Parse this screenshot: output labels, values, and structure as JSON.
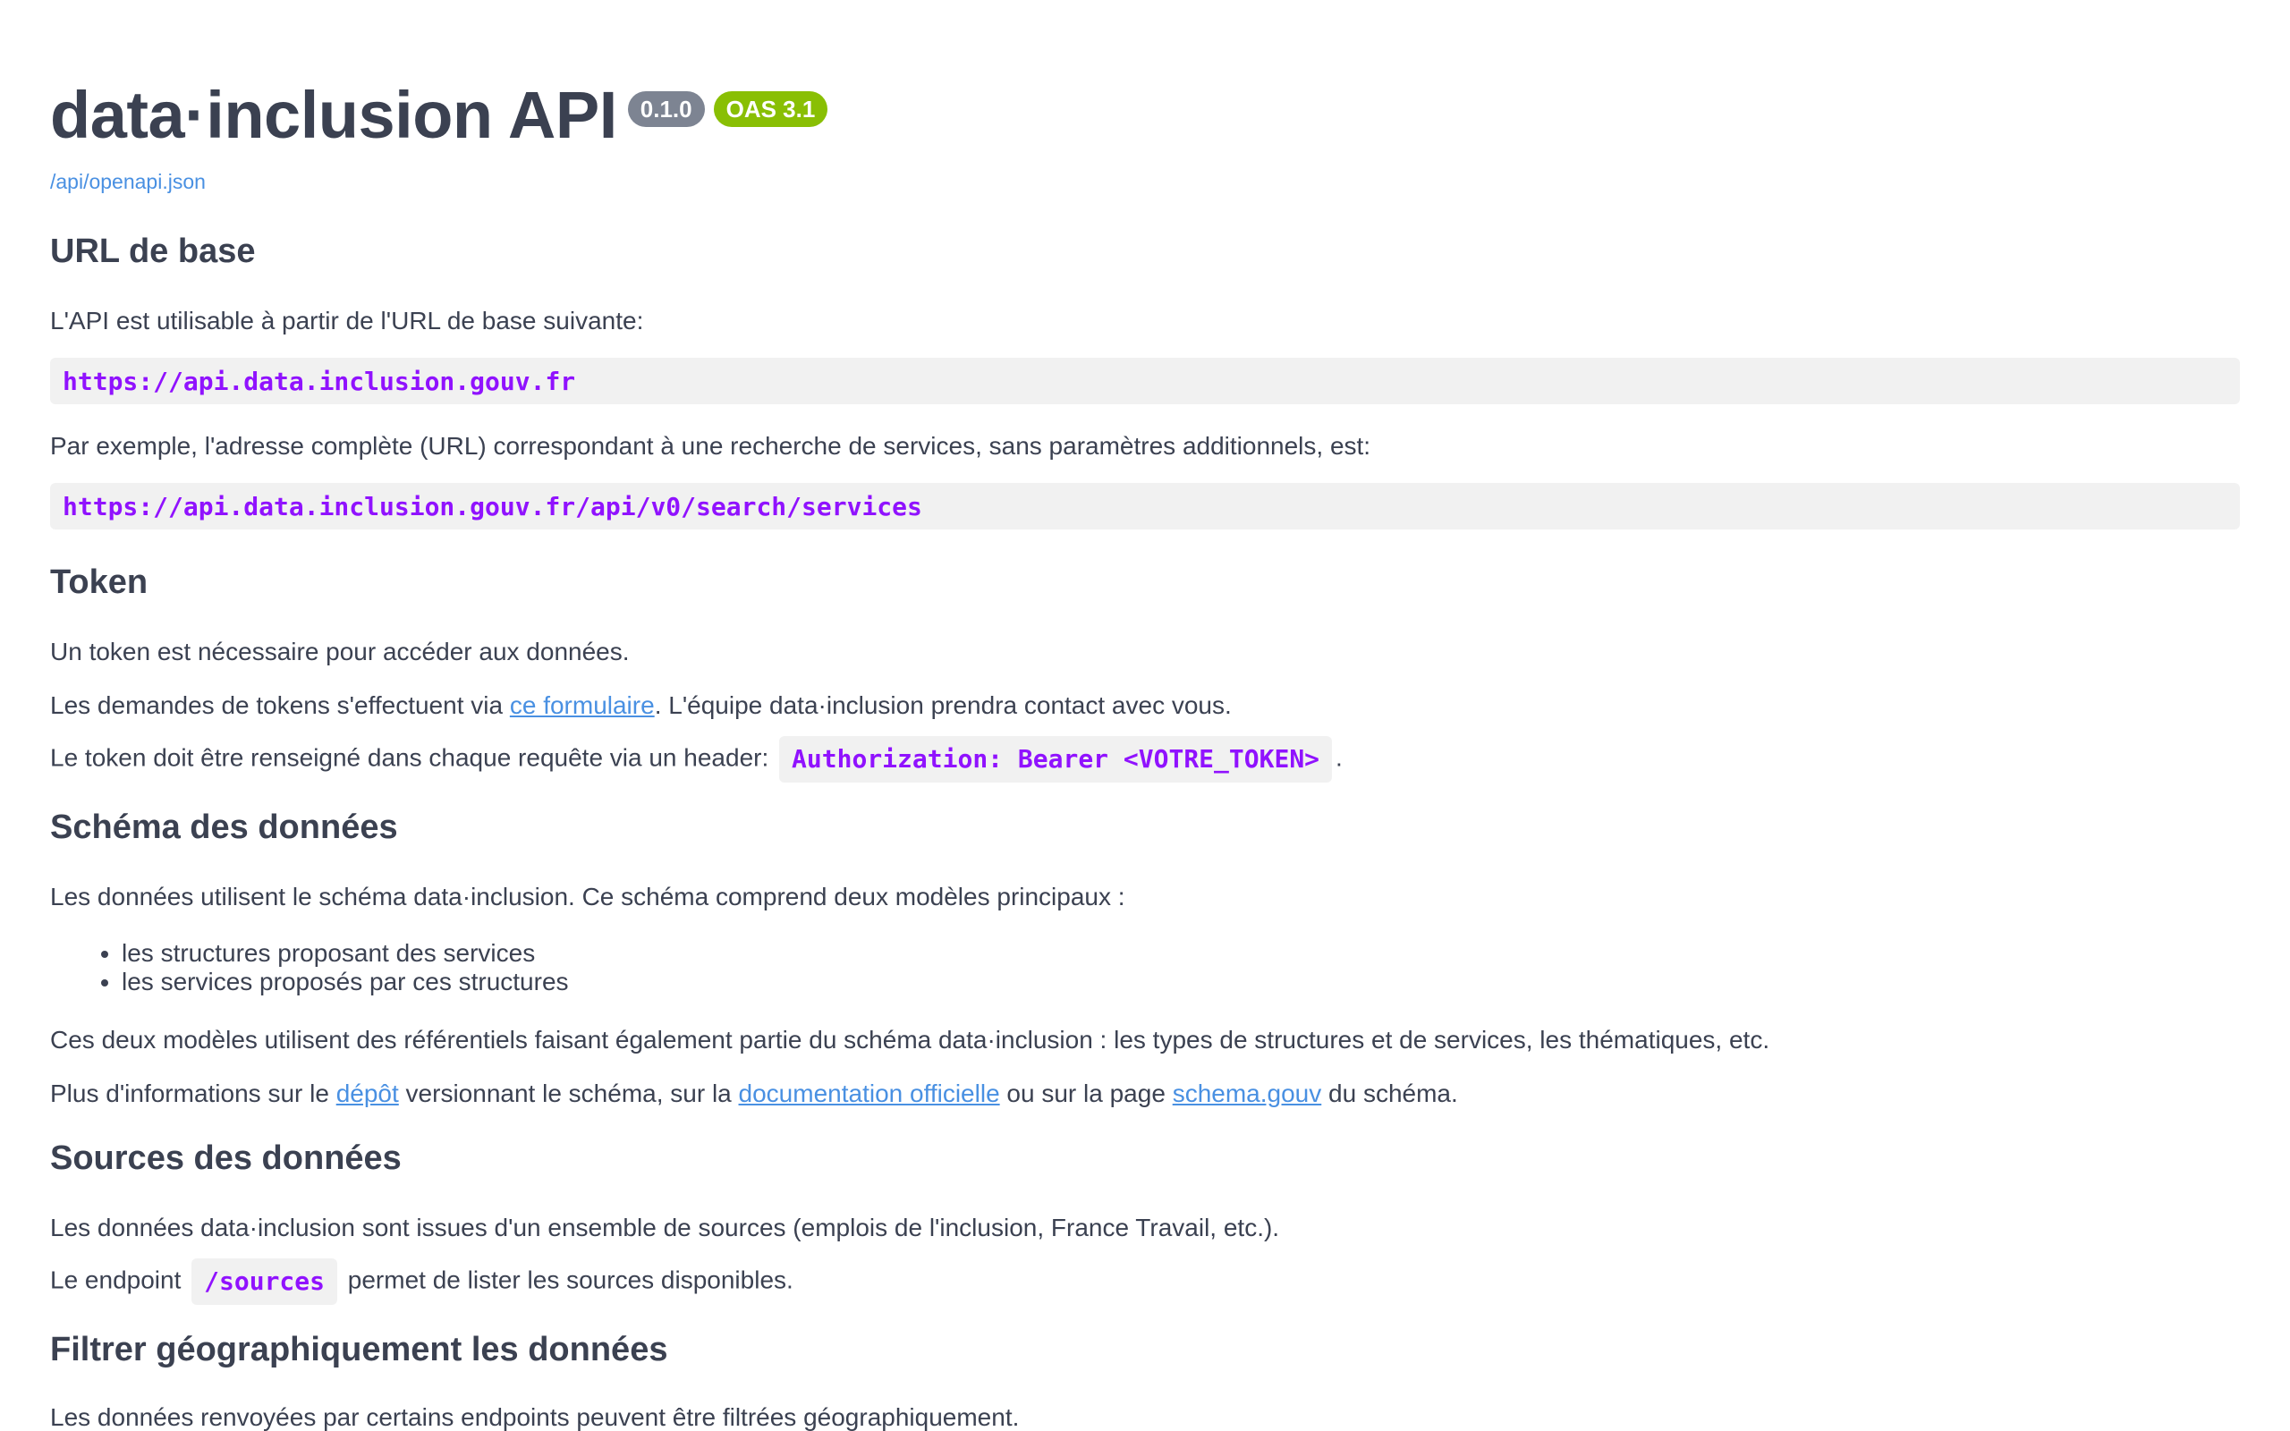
{
  "header": {
    "title": "data·inclusion API",
    "version_badge": "0.1.0",
    "oas_badge": "OAS 3.1",
    "spec_link": "/api/openapi.json"
  },
  "sections": {
    "base_url": {
      "heading": "URL de base",
      "intro": "L'API est utilisable à partir de l'URL de base suivante:",
      "base_url_code": "https://api.data.inclusion.gouv.fr",
      "example_text": "Par exemple, l'adresse complète (URL) correspondant à une recherche de services, sans paramètres additionnels, est:",
      "example_code": "https://api.data.inclusion.gouv.fr/api/v0/search/services"
    },
    "token": {
      "heading": "Token",
      "line1": "Un token est nécessaire pour accéder aux données.",
      "line2_before": "Les demandes de tokens s'effectuent via ",
      "line2_link": "ce formulaire",
      "line2_after": ". L'équipe data·inclusion prendra contact avec vous.",
      "line3_before": "Le token doit être renseigné dans chaque requête via un header: ",
      "line3_code": "Authorization: Bearer <VOTRE_TOKEN>",
      "line3_after": "."
    },
    "schema": {
      "heading": "Schéma des données",
      "intro": "Les données utilisent le schéma data·inclusion. Ce schéma comprend deux modèles principaux :",
      "items": [
        "les structures proposant des services",
        "les services proposés par ces structures"
      ],
      "refs": "Ces deux modèles utilisent des référentiels faisant également partie du schéma data·inclusion : les types de structures et de services, les thématiques, etc.",
      "more_1": "Plus d'informations sur le ",
      "more_link1": "dépôt",
      "more_2": " versionnant le schéma, sur la ",
      "more_link2": "documentation officielle",
      "more_3": " ou sur la page ",
      "more_link3": "schema.gouv",
      "more_4": " du schéma."
    },
    "sources": {
      "heading": "Sources des données",
      "intro": "Les données data·inclusion sont issues d'un ensemble de sources (emplois de l'inclusion, France Travail, etc.).",
      "endpoint_before": "Le endpoint ",
      "endpoint_code": "/sources",
      "endpoint_after": " permet de lister les sources disponibles."
    },
    "geo": {
      "heading": "Filtrer géographiquement les données",
      "intro": "Les données renvoyées par certains endpoints peuvent être filtrées géographiquement."
    }
  },
  "colors": {
    "text": "#3b4151",
    "link": "#4990e2",
    "code": "#9012fe",
    "version_badge": "#7d8492",
    "oas_badge": "#89bf04",
    "code_bg": "#f1f1f1"
  }
}
